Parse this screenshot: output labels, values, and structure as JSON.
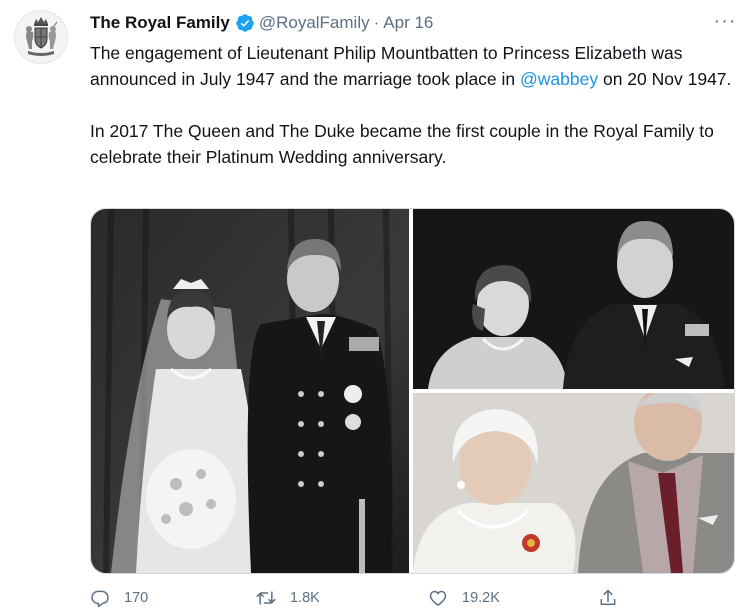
{
  "tweet": {
    "author_name": "The Royal Family",
    "handle": "@RoyalFamily",
    "separator": "·",
    "date": "Apr 16",
    "more_label": "···",
    "text_para1_before": "The engagement of Lieutenant Philip Mountbatten to Princess Elizabeth was announced in July 1947 and the marriage took place in ",
    "mention": "@wabbey",
    "text_para1_after": " on 20 Nov 1947.",
    "text_para2": "In 2017 The Queen and The Duke became the first couple in the Royal Family to celebrate their Platinum Wedding anniversary.",
    "colors": {
      "text": "#0f1419",
      "secondary": "#5b7083",
      "link": "#1b95e0",
      "verified": "#1da1f2"
    }
  },
  "media": {
    "photos": [
      {
        "icon": "wedding-photo-image"
      },
      {
        "icon": "engagement-photo-image"
      },
      {
        "icon": "platinum-anniversary-photo-image"
      }
    ]
  },
  "actions": {
    "reply": {
      "icon": "reply-icon",
      "count": "170"
    },
    "retweet": {
      "icon": "retweet-icon",
      "count": "1.8K"
    },
    "like": {
      "icon": "heart-icon",
      "count": "19.2K"
    },
    "share": {
      "icon": "share-icon"
    }
  }
}
